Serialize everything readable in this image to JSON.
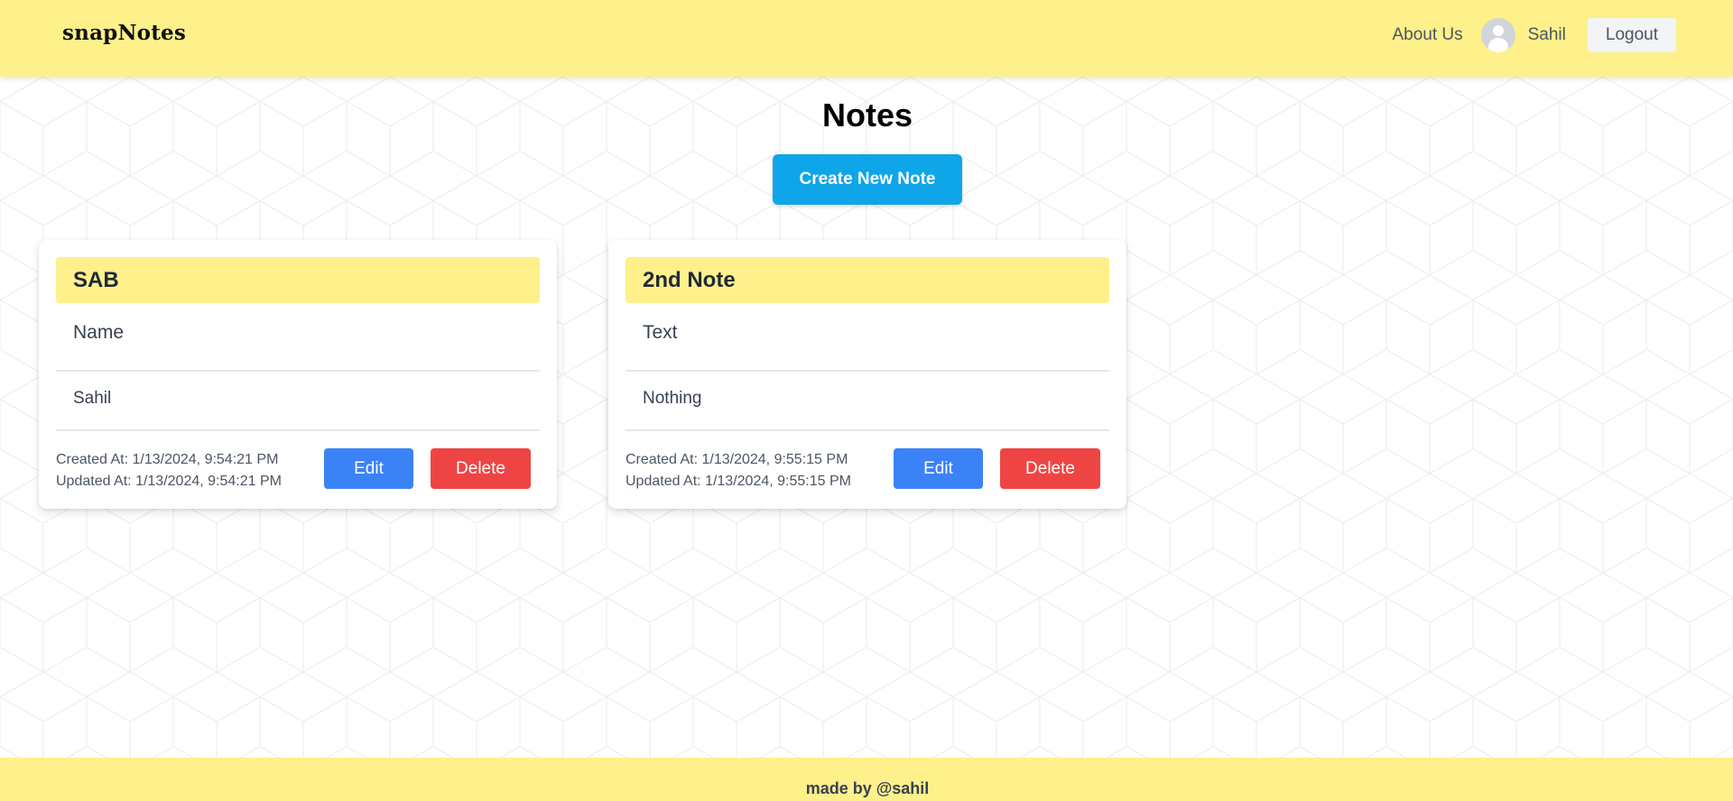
{
  "header": {
    "brand": "snapNotes",
    "about_label": "About Us",
    "user_name": "Sahil",
    "logout_label": "Logout"
  },
  "main": {
    "title": "Notes",
    "create_label": "Create New Note"
  },
  "notes": [
    {
      "title": "SAB",
      "field_label": "Name",
      "content": "Sahil",
      "created": "Created At: 1/13/2024, 9:54:21 PM",
      "updated": "Updated At: 1/13/2024, 9:54:21 PM",
      "edit_label": "Edit",
      "delete_label": "Delete"
    },
    {
      "title": "2nd Note",
      "field_label": "Text",
      "content": "Nothing",
      "created": "Created At: 1/13/2024, 9:55:15 PM",
      "updated": "Updated At: 1/13/2024, 9:55:15 PM",
      "edit_label": "Edit",
      "delete_label": "Delete"
    }
  ],
  "footer": {
    "text": "made by @sahil"
  },
  "colors": {
    "header_bg": "#fef08a",
    "create_button": "#0ea5e9",
    "edit_button": "#3b82f6",
    "delete_button": "#ef4444",
    "avatar": "#d1d5db"
  },
  "icons": {
    "avatar": "user-avatar-icon"
  }
}
